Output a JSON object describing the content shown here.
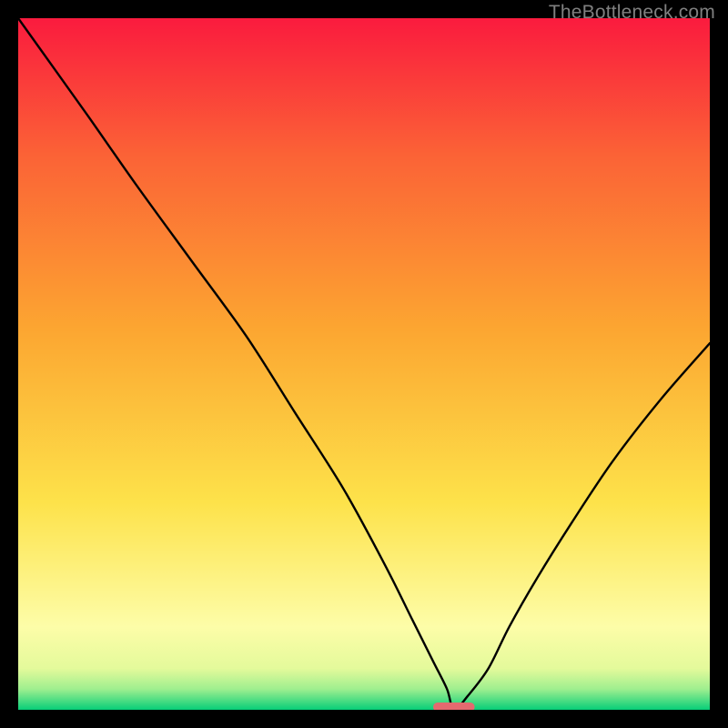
{
  "watermark": "TheBottleneck.com",
  "chart_data": {
    "type": "line",
    "title": "",
    "xlabel": "",
    "ylabel": "",
    "xlim": [
      0,
      1
    ],
    "ylim": [
      0,
      1
    ],
    "gradient_stops": [
      {
        "offset": 0.0,
        "color": "#07ce79"
      },
      {
        "offset": 0.03,
        "color": "#9fef8f"
      },
      {
        "offset": 0.06,
        "color": "#e4fa9b"
      },
      {
        "offset": 0.12,
        "color": "#fdfda8"
      },
      {
        "offset": 0.3,
        "color": "#fde24a"
      },
      {
        "offset": 0.55,
        "color": "#fca631"
      },
      {
        "offset": 0.8,
        "color": "#fb6336"
      },
      {
        "offset": 1.0,
        "color": "#fa1b3e"
      }
    ],
    "series": [
      {
        "name": "bottleneck-curve",
        "x": [
          0.0,
          0.05,
          0.1,
          0.17,
          0.25,
          0.33,
          0.4,
          0.47,
          0.53,
          0.57,
          0.6,
          0.62,
          0.63,
          0.65,
          0.68,
          0.71,
          0.75,
          0.8,
          0.86,
          0.93,
          1.0
        ],
        "y": [
          1.0,
          0.93,
          0.86,
          0.76,
          0.65,
          0.54,
          0.43,
          0.32,
          0.21,
          0.13,
          0.07,
          0.03,
          0.0,
          0.02,
          0.06,
          0.12,
          0.19,
          0.27,
          0.36,
          0.45,
          0.53
        ]
      }
    ],
    "plateau": {
      "x0": 0.6,
      "x1": 0.66,
      "y": 0.004,
      "color": "#e46a6f"
    }
  }
}
